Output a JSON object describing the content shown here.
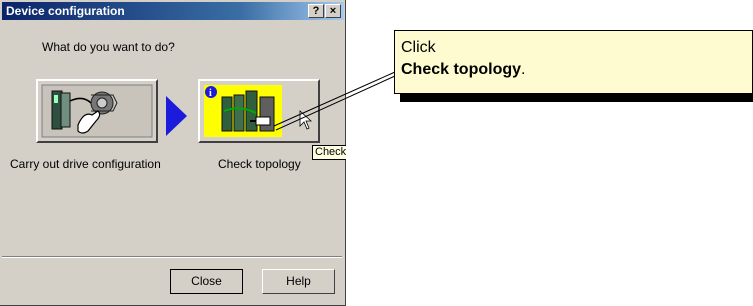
{
  "dialog": {
    "title": "Device configuration",
    "help_button": "?",
    "close_button": "×",
    "question": "What do you want to do?",
    "option_drive_label": "Carry out drive configuration",
    "option_topology_label": "Check topology",
    "tooltip": "Check t",
    "close_label": "Close",
    "help_label": "Help"
  },
  "callout": {
    "line1": "Click",
    "line2_bold": "Check topology",
    "line2_tail": "."
  },
  "icons": {
    "drive": "drive-config-icon",
    "topology": "topology-icon",
    "arrow": "blue-right-arrow-icon",
    "cursor": "mouse-pointer-icon"
  },
  "colors": {
    "title_start": "#0a246a",
    "dialog_bg": "#d4d0c8",
    "topology_bg": "#ffff00",
    "arrow": "#1b1bdc",
    "callout_bg": "#fffbd0"
  }
}
